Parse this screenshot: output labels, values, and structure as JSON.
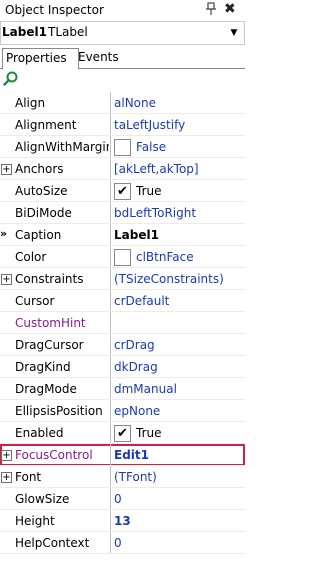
{
  "window": {
    "title": "Object Inspector",
    "pin_icon": "pin-icon",
    "close_glyph": "✖"
  },
  "component": {
    "name": "Label1",
    "type": "TLabel"
  },
  "tabs": [
    {
      "label": "Properties",
      "active": true
    },
    {
      "label": "Events",
      "active": false
    }
  ],
  "toolbar": {
    "search_icon": "search-icon"
  },
  "colors": {
    "value_blue": "#1a3bb0",
    "highlight_purple": "#8b1a8b",
    "selected_border": "#cc2244"
  },
  "properties": [
    {
      "name": "Align",
      "value": "alNone"
    },
    {
      "name": "Alignment",
      "value": "taLeftJustify"
    },
    {
      "name": "AlignWithMargin",
      "value": "False",
      "checkbox": true,
      "checked": false
    },
    {
      "name": "Anchors",
      "value": "[akLeft,akTop]",
      "expandable": true
    },
    {
      "name": "AutoSize",
      "value": "True",
      "checkbox": true,
      "checked": true
    },
    {
      "name": "BiDiMode",
      "value": "bdLeftToRight"
    },
    {
      "name": "Caption",
      "value": "Label1",
      "bold": true,
      "marker": "»"
    },
    {
      "name": "Color",
      "value": "clBtnFace",
      "swatch": true
    },
    {
      "name": "Constraints",
      "value": "(TSizeConstraints)",
      "expandable": true
    },
    {
      "name": "Cursor",
      "value": "crDefault"
    },
    {
      "name": "CustomHint",
      "value": "",
      "purple": true
    },
    {
      "name": "DragCursor",
      "value": "crDrag"
    },
    {
      "name": "DragKind",
      "value": "dkDrag"
    },
    {
      "name": "DragMode",
      "value": "dmManual"
    },
    {
      "name": "EllipsisPosition",
      "value": "epNone"
    },
    {
      "name": "Enabled",
      "value": "True",
      "checkbox": true,
      "checked": true
    },
    {
      "name": "FocusControl",
      "value": "Edit1",
      "expandable": true,
      "selected": true,
      "bold": true
    },
    {
      "name": "Font",
      "value": "(TFont)",
      "expandable": true
    },
    {
      "name": "GlowSize",
      "value": "0"
    },
    {
      "name": "Height",
      "value": "13",
      "bold": true
    },
    {
      "name": "HelpContext",
      "value": "0"
    }
  ]
}
